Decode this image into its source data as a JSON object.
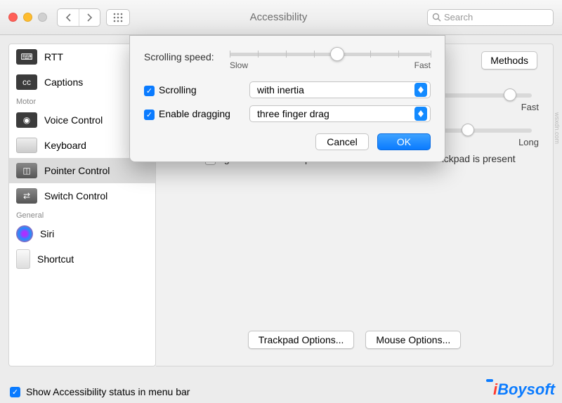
{
  "window": {
    "title": "Accessibility"
  },
  "search": {
    "placeholder": "Search"
  },
  "sidebar": {
    "groups": {
      "motor": "Motor",
      "general": "General"
    },
    "items": [
      {
        "label": "RTT"
      },
      {
        "label": "Captions"
      },
      {
        "label": "Voice Control"
      },
      {
        "label": "Keyboard"
      },
      {
        "label": "Pointer Control"
      },
      {
        "label": "Switch Control"
      },
      {
        "label": "Siri"
      },
      {
        "label": "Shortcut"
      }
    ]
  },
  "content": {
    "methods_btn": "Methods",
    "slider1_end": "Fast",
    "slider2_end": "Long",
    "ignore_label": "Ignore built-in trackpad when mouse or wireless trackpad is present",
    "trackpad_btn": "Trackpad Options...",
    "mouse_btn": "Mouse Options..."
  },
  "sheet": {
    "speed_label": "Scrolling speed:",
    "slow": "Slow",
    "fast": "Fast",
    "scrolling_label": "Scrolling",
    "scrolling_value": "with inertia",
    "dragging_label": "Enable dragging",
    "dragging_value": "three finger drag",
    "cancel": "Cancel",
    "ok": "OK"
  },
  "footer": {
    "show_status": "Show Accessibility status in menu bar"
  },
  "watermark": {
    "text_i": "i",
    "text_rest": "Boysoft"
  },
  "sidetext": "wsxdn.com"
}
